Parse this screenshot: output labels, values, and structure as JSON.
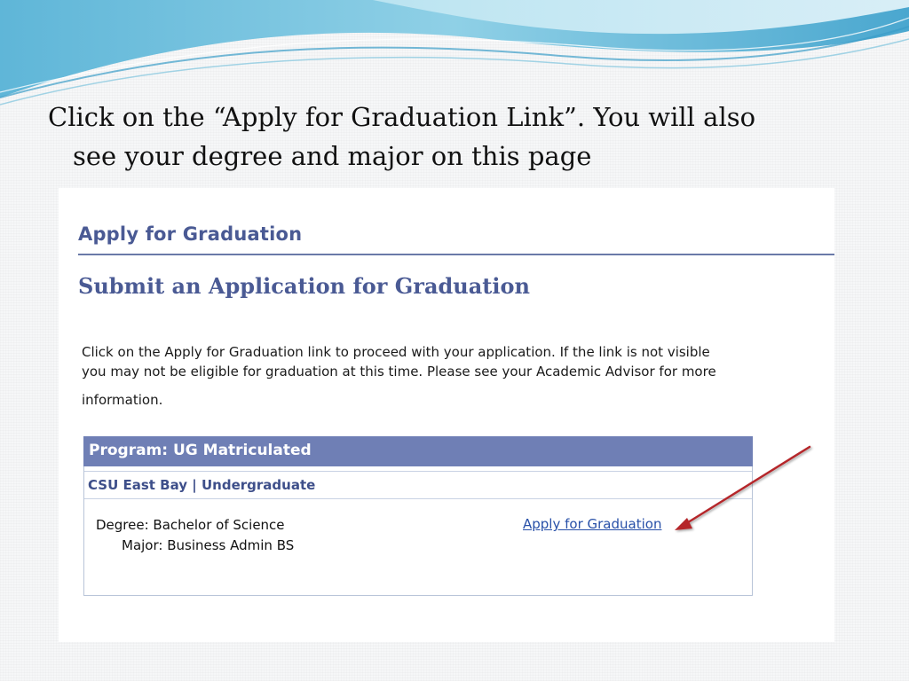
{
  "slide": {
    "title_line1": "Click on the “Apply for Graduation Link”. You will also",
    "title_line2": "see your degree and major on this page"
  },
  "screenshot": {
    "page_header": "Apply for Graduation",
    "sub_header": "Submit an Application for Graduation",
    "instructions_line1": "Click on the Apply for Graduation link to proceed with your application. If the link is not visible",
    "instructions_line2": "you may not be eligible for graduation at this time. Please see your Academic Advisor for more",
    "instructions_line3": "information.",
    "program_title": "Program: UG Matriculated",
    "career": "CSU East Bay | Undergraduate",
    "degree": "Degree: Bachelor of Science",
    "major": "Major: Business Admin BS",
    "apply_link": "Apply for Graduation"
  },
  "colors": {
    "heading": "#4a5a94",
    "program_bar": "#6f7fb5",
    "link": "#2850a8",
    "arrow": "#b5262a"
  },
  "icons": {
    "annotation": "red-arrow-icon"
  }
}
